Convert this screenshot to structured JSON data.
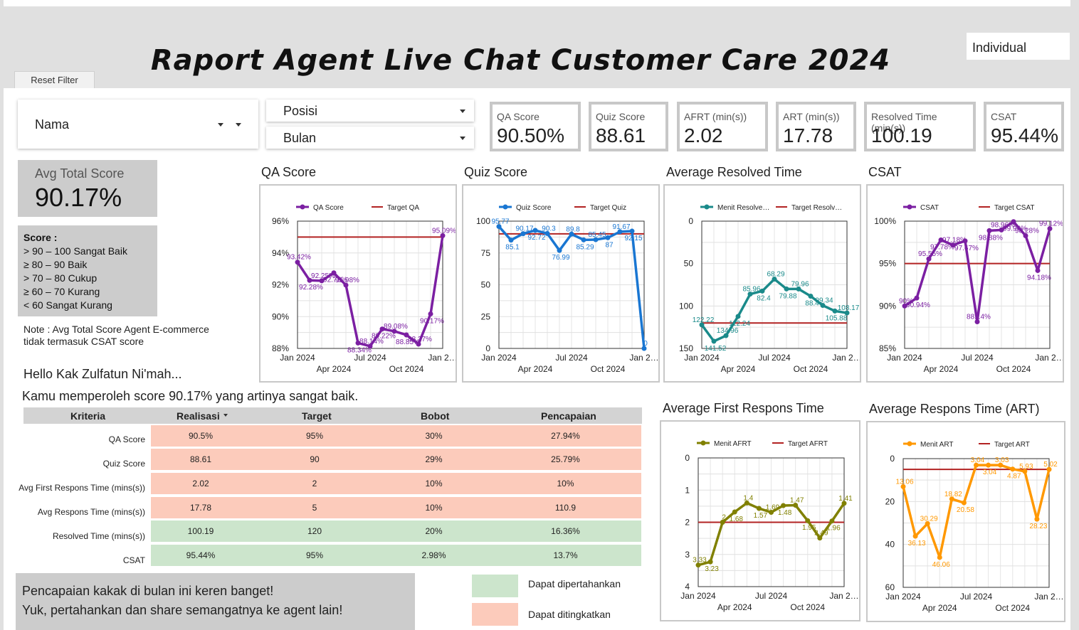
{
  "header": {
    "title": "Raport Agent Live Chat Customer Care 2024",
    "reset_label": "Reset Filter",
    "view_mode": "Individual"
  },
  "filters": {
    "nama": "Nama",
    "posisi": "Posisi",
    "bulan": "Bulan"
  },
  "kpis": [
    {
      "label": "QA Score",
      "value": "90.50%"
    },
    {
      "label": "Quiz Score",
      "value": "88.61"
    },
    {
      "label": "AFRT (min(s))",
      "value": "2.02"
    },
    {
      "label": "ART (min(s))",
      "value": "17.78"
    },
    {
      "label": "Resolved Time (min(s))",
      "value": "100.19"
    },
    {
      "label": "CSAT",
      "value": "95.44%"
    }
  ],
  "avg_total": {
    "label": "Avg Total Score",
    "value": "90.17%"
  },
  "score_legend": {
    "heading": "Score :",
    "lines": [
      "> 90 – 100 Sangat Baik",
      "≥ 80 – 90 Baik",
      "> 70 – 80 Cukup",
      "≥ 60 – 70 Kurang",
      "< 60 Sangat Kurang"
    ]
  },
  "note": "Note : Avg Total Score Agent E-commerce tidak termasuk CSAT score",
  "greeting": "Hello Kak Zulfatun Ni'mah...",
  "message": "Kamu memperoleh score 90.17% yang artinya sangat baik.",
  "table": {
    "headers": [
      "Kriteria",
      "Realisasi",
      "Target",
      "Bobot",
      "Pencapaian"
    ],
    "sort_icon": "sort-down-icon",
    "rows": [
      {
        "kriteria": "QA Score",
        "realisasi": "90.5%",
        "target": "95%",
        "bobot": "30%",
        "pencapaian": "27.94%",
        "status": "ditingkatkan"
      },
      {
        "kriteria": "Quiz Score",
        "realisasi": "88.61",
        "target": "90",
        "bobot": "29%",
        "pencapaian": "25.79%",
        "status": "ditingkatkan"
      },
      {
        "kriteria": "Avg First Respons Time (mins(s))",
        "realisasi": "2.02",
        "target": "2",
        "bobot": "10%",
        "pencapaian": "10%",
        "status": "ditingkatkan"
      },
      {
        "kriteria": "Avg Respons Time (mins(s))",
        "realisasi": "17.78",
        "target": "5",
        "bobot": "10%",
        "pencapaian": "110.9",
        "status": "ditingkatkan"
      },
      {
        "kriteria": "Resolved Time (mins(s))",
        "realisasi": "100.19",
        "target": "120",
        "bobot": "20%",
        "pencapaian": "16.36%",
        "status": "dipertahankan"
      },
      {
        "kriteria": "CSAT",
        "realisasi": "95.44%",
        "target": "95%",
        "bobot": "2.98%",
        "pencapaian": "13.7%",
        "status": "dipertahankan"
      }
    ]
  },
  "bottom_message": {
    "line1": "Pencapaian kakak di bulan ini keren banget!",
    "line2": "Yuk, pertahankan dan share semangatnya ke agent lain!"
  },
  "status_legend": {
    "dipertahankan": "Dapat dipertahankan",
    "ditingkatkan": "Dapat ditingkatkan"
  },
  "colors": {
    "green": "#cce5cc",
    "salmon": "#fccbbb",
    "target_line": "#b22222",
    "qa": "#7b1fa2",
    "quiz": "#1976d2",
    "resolved": "#1a8a8a",
    "csat": "#7b1fa2",
    "afrt": "#808000",
    "art": "#ff9800"
  },
  "chart_data": [
    {
      "id": "qa",
      "title": "QA Score",
      "type": "line",
      "series": [
        {
          "name": "QA Score",
          "values": [
            93.42,
            92.28,
            92.25,
            92.75,
            91.98,
            88.34,
            88.14,
            89.22,
            89.08,
            88.85,
            88.27,
            90.17,
            95.09
          ]
        },
        {
          "name": "Target QA",
          "values": [
            95,
            95,
            95,
            95,
            95,
            95,
            95,
            95,
            95,
            95,
            95,
            95,
            95
          ]
        }
      ],
      "x_ticks": [
        "Jan 2024",
        "Apr 2024",
        "Jul 2024",
        "Oct 2024",
        "Jan 2…"
      ],
      "y_ticks": [
        "96%",
        "94%",
        "92%",
        "90%",
        "88%"
      ],
      "ylim": [
        88,
        96
      ],
      "labels": [
        "93.42%",
        "92.28%",
        "92.25%",
        "92.75%",
        "91.98%",
        "88.34%",
        "88.14%",
        "89.22%",
        "89.08%",
        "88.85%",
        "88.27%",
        "90.17%",
        "95.09%"
      ]
    },
    {
      "id": "quiz",
      "title": "Quiz Score",
      "type": "line",
      "series": [
        {
          "name": "Quiz Score",
          "values": [
            95.77,
            85.1,
            90.17,
            92.72,
            90.3,
            76.99,
            89.8,
            85.29,
            85.45,
            87,
            91.67,
            92.15,
            0
          ]
        },
        {
          "name": "Target Quiz",
          "values": [
            90,
            90,
            90,
            90,
            90,
            90,
            90,
            90,
            90,
            90,
            90,
            90,
            90
          ]
        }
      ],
      "x_ticks": [
        "Jan 2024",
        "Apr 2024",
        "Jul 2024",
        "Oct 2024",
        "Jan 2…"
      ],
      "y_ticks": [
        "100",
        "75",
        "50",
        "25",
        "0"
      ],
      "ylim": [
        0,
        100
      ],
      "labels": [
        "95.77",
        "85.1",
        "90.17",
        "92.72",
        "90.3",
        "76.99",
        "89.8",
        "85.29",
        "85.45",
        "87",
        "91.67",
        "92.15",
        "0"
      ]
    },
    {
      "id": "resolved",
      "title": "Average Resolved Time",
      "type": "line",
      "series": [
        {
          "name": "Menit Resolve…",
          "values": [
            122.22,
            141.52,
            134.96,
            112.24,
            85.96,
            82.4,
            68.29,
            79.88,
            79.96,
            88.4,
            99.34,
            105.88,
            108.17
          ]
        },
        {
          "name": "Target Resolv…",
          "values": [
            120,
            120,
            120,
            120,
            120,
            120,
            120,
            120,
            120,
            120,
            120,
            120,
            120
          ]
        }
      ],
      "x_ticks": [
        "Jan 2024",
        "Apr 2024",
        "Jul 2024",
        "Oct 2024",
        "Jan 2…"
      ],
      "y_ticks": [
        "0",
        "50",
        "100",
        "150"
      ],
      "ylim": [
        0,
        150
      ],
      "reversed": true,
      "labels": [
        "122.22",
        "141.52",
        "134.96",
        "112.24",
        "85.96",
        "82.4",
        "68.29",
        "79.88",
        "79.96",
        "88.4",
        "99.34",
        "105.88",
        "108.17"
      ]
    },
    {
      "id": "csat",
      "title": "CSAT",
      "type": "line",
      "series": [
        {
          "name": "CSAT",
          "values": [
            90,
            90.94,
            95.55,
            97.78,
            97.18,
            97.67,
            88.14,
            98.88,
            98.96,
            99.94,
            98.28,
            94.18,
            99.12
          ]
        },
        {
          "name": "Target CSAT",
          "values": [
            95,
            95,
            95,
            95,
            95,
            95,
            95,
            95,
            95,
            95,
            95,
            95,
            95
          ]
        }
      ],
      "x_ticks": [
        "Jan 2024",
        "Apr 2024",
        "Jul 2024",
        "Oct 2024",
        "Jan 2…"
      ],
      "y_ticks": [
        "100%",
        "95%",
        "90%",
        "85%"
      ],
      "ylim": [
        85,
        100
      ],
      "labels": [
        "90%",
        "90.94%",
        "95.55%",
        "97.78%",
        "97.18%",
        "97.67%",
        "88.14%",
        "98.88%",
        "98.96%",
        "99.94%",
        "98.28%",
        "94.18%",
        "99.12%"
      ]
    },
    {
      "id": "afrt",
      "title": "Average First Respons Time",
      "type": "line",
      "series": [
        {
          "name": "Menit AFRT",
          "values": [
            3.33,
            3.23,
            2,
            1.68,
            1.4,
            1.57,
            1.69,
            1.48,
            1.47,
            1.95,
            2.49,
            1.96,
            1.41
          ]
        },
        {
          "name": "Target AFRT",
          "values": [
            2,
            2,
            2,
            2,
            2,
            2,
            2,
            2,
            2,
            2,
            2,
            2,
            2
          ]
        }
      ],
      "x_ticks": [
        "Jan 2024",
        "Apr 2024",
        "Jul 2024",
        "Oct 2024",
        "Jan 2…"
      ],
      "y_ticks": [
        "0",
        "1",
        "2",
        "3",
        "4"
      ],
      "ylim": [
        0,
        4
      ],
      "reversed": true,
      "labels": [
        "3.33",
        "3.23",
        "2",
        "1.68",
        "1.4",
        "1.57",
        "1.69",
        "1.48",
        "1.47",
        "1.95",
        "2.49",
        "1.96",
        "1.41"
      ]
    },
    {
      "id": "art",
      "title": "Average Respons Time (ART)",
      "type": "line",
      "series": [
        {
          "name": "Menit ART",
          "values": [
            13.06,
            36.13,
            30.29,
            46.06,
            18.82,
            20.58,
            3.04,
            3.04,
            3.03,
            4.87,
            5.93,
            28.23,
            5.02
          ]
        },
        {
          "name": "Target ART",
          "values": [
            5,
            5,
            5,
            5,
            5,
            5,
            5,
            5,
            5,
            5,
            5,
            5,
            5
          ]
        }
      ],
      "x_ticks": [
        "Jan 2024",
        "Apr 2024",
        "Jul 2024",
        "Oct 2024",
        "Jan 2…"
      ],
      "y_ticks": [
        "0",
        "20",
        "40",
        "60"
      ],
      "ylim": [
        0,
        60
      ],
      "reversed": true,
      "labels": [
        "13.06",
        "36.13",
        "30.29",
        "46.06",
        "18.82",
        "20.58",
        "3.04",
        "3.04",
        "3.03",
        "4.87",
        "5.93",
        "28.23",
        "5.02"
      ]
    }
  ]
}
